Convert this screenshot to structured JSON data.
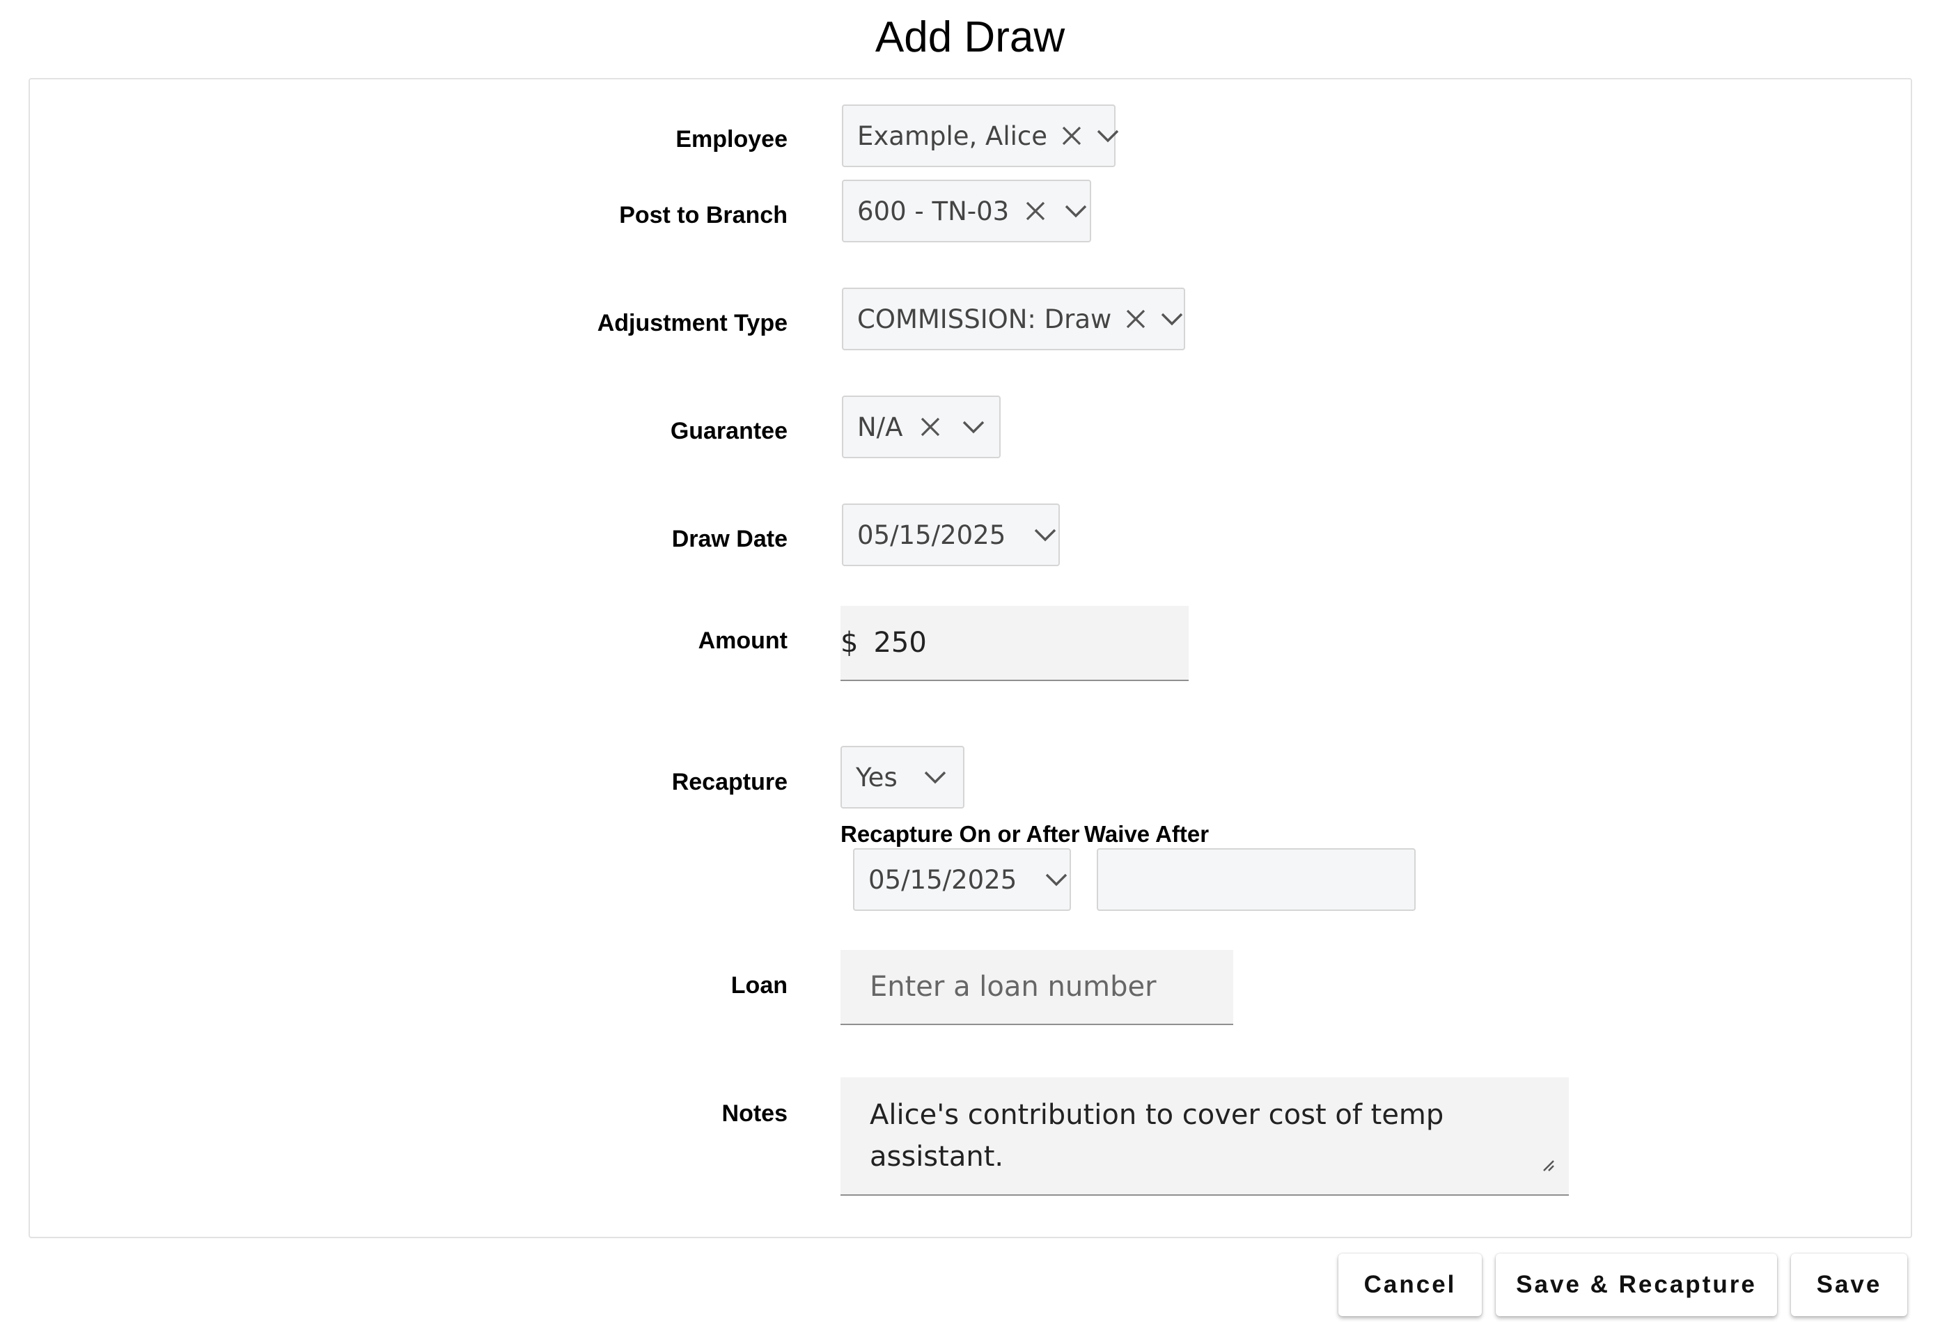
{
  "dialog": {
    "title": "Add Draw"
  },
  "form": {
    "employee": {
      "label": "Employee",
      "value": "Example, Alice"
    },
    "post_to_branch": {
      "label": "Post to Branch",
      "value": "600 - TN-03"
    },
    "adjustment_type": {
      "label": "Adjustment Type",
      "value": "COMMISSION: Draw"
    },
    "guarantee": {
      "label": "Guarantee",
      "value": "N/A"
    },
    "draw_date": {
      "label": "Draw Date",
      "value": "05/15/2025"
    },
    "amount": {
      "label": "Amount",
      "currency_symbol": "$",
      "value": "250"
    },
    "recapture": {
      "label": "Recapture",
      "value": "Yes",
      "recapture_on_or_after": {
        "label": "Recapture On or After",
        "value": "05/15/2025"
      },
      "waive_after": {
        "label": "Waive After",
        "value": ""
      }
    },
    "loan": {
      "label": "Loan",
      "placeholder": "Enter a loan number",
      "value": ""
    },
    "notes": {
      "label": "Notes",
      "value": "Alice's contribution to cover cost of temp assistant."
    }
  },
  "actions": {
    "cancel": "Cancel",
    "save_recapture": "Save & Recapture",
    "save": "Save"
  },
  "icons": {
    "clear": "close-icon",
    "dropdown": "chevron-down-icon",
    "resize": "resize-handle-icon"
  },
  "colors": {
    "field_bg": "#f5f6f7",
    "filled_bg": "#f3f3f3",
    "border": "#d5d5d5",
    "panel_border": "#e2e2e2"
  }
}
